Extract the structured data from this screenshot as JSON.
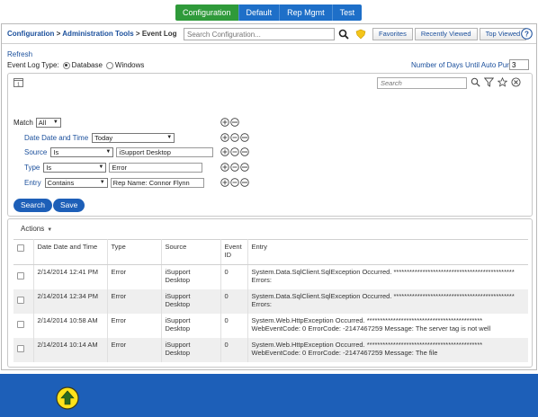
{
  "topnav": {
    "tabs": [
      {
        "label": "Configuration",
        "active": true
      },
      {
        "label": "Default",
        "active": false
      },
      {
        "label": "Rep Mgmt",
        "active": false
      },
      {
        "label": "Test",
        "active": false
      }
    ]
  },
  "header": {
    "breadcrumb": [
      "Configuration",
      "Administration Tools",
      "Event Log"
    ],
    "separator": ">",
    "search_placeholder": "Search Configuration...",
    "buttons": [
      "Favorites",
      "Recently Viewed",
      "Top Viewed"
    ]
  },
  "options": {
    "refresh": "Refresh",
    "event_log_type_label": "Event Log Type:",
    "database_label": "Database",
    "windows_label": "Windows",
    "selected_type": "Database",
    "purge_label": "Number of Days Until Auto Purge:",
    "purge_value": "3"
  },
  "filter": {
    "search_placeholder": "Search",
    "match_label": "Match",
    "match_value": "All",
    "rows": [
      {
        "label": "Date Date and Time",
        "operator": "Today",
        "value": null
      },
      {
        "label": "Source",
        "operator": "Is",
        "value": "iSupport Desktop"
      },
      {
        "label": "Type",
        "operator": "Is",
        "value": "Error"
      },
      {
        "label": "Entry",
        "operator": "Contains",
        "value": "Rep Name: Connor Flynn"
      }
    ],
    "search_button": "Search",
    "save_button": "Save"
  },
  "grid": {
    "actions_label": "Actions",
    "columns": [
      "Date Date and Time",
      "Type",
      "Source",
      "Event ID",
      "Entry"
    ],
    "rows": [
      {
        "date": "2/14/2014 12:41 PM",
        "type": "Error",
        "source": "iSupport Desktop",
        "event_id": "0",
        "entry": "System.Data.SqlClient.SqlException Occurred. ********************************************** Errors:"
      },
      {
        "date": "2/14/2014 12:34 PM",
        "type": "Error",
        "source": "iSupport Desktop",
        "event_id": "0",
        "entry": "System.Data.SqlClient.SqlException Occurred. ********************************************** Errors:"
      },
      {
        "date": "2/14/2014 10:58 AM",
        "type": "Error",
        "source": "iSupport Desktop",
        "event_id": "0",
        "entry": "System.Web.HttpException Occurred. ******************************************** WebEventCode: 0 ErrorCode: -2147467259 Message: The server tag is not well"
      },
      {
        "date": "2/14/2014 10:14 AM",
        "type": "Error",
        "source": "iSupport Desktop",
        "event_id": "0",
        "entry": "System.Web.HttpException Occurred. ******************************************** WebEventCode: 0 ErrorCode: -2147467259 Message: The file"
      }
    ]
  },
  "colors": {
    "nav_blue": "#1e6fc8",
    "nav_active_green": "#2f9a3a",
    "link_blue": "#1a4f9c",
    "footer_blue": "#1d5fb8",
    "upload_yellow": "#ffe31a"
  },
  "icons": [
    "search-icon",
    "badge-icon",
    "help-icon",
    "calendar-icon",
    "filter-icon",
    "star-icon",
    "clear-icon",
    "add-icon",
    "remove-icon",
    "more-icon",
    "upload-arrow-icon"
  ]
}
